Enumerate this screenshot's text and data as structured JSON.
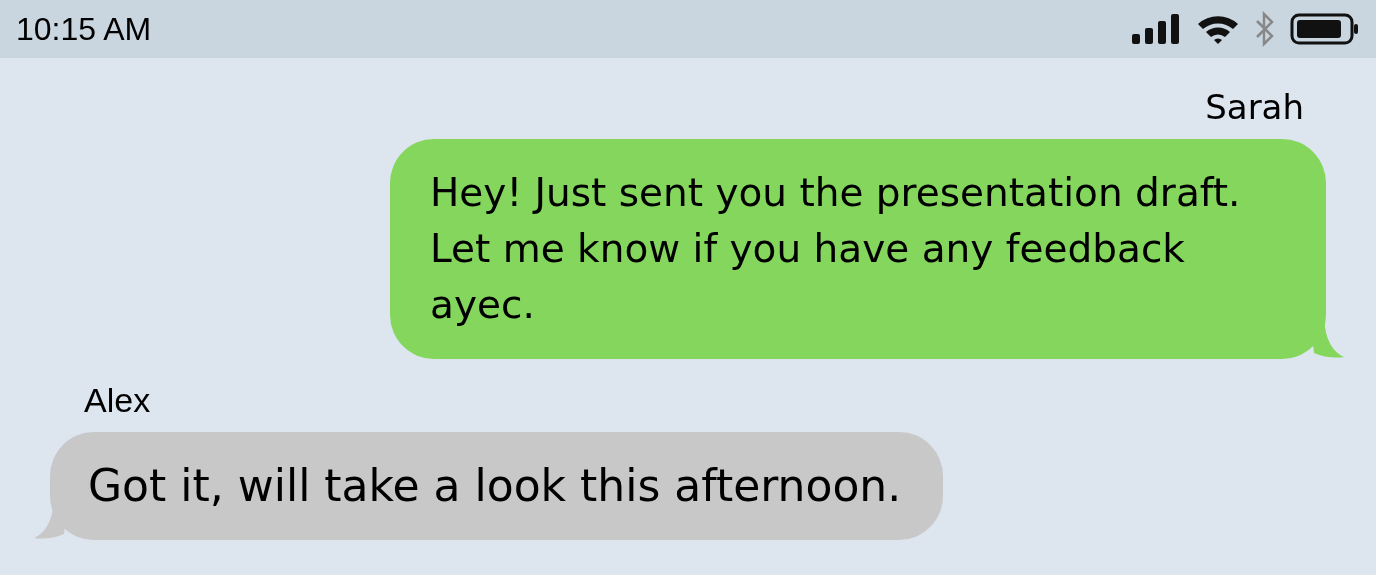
{
  "status_bar": {
    "time": "10:15 AM"
  },
  "messages": [
    {
      "sender": "Sarah",
      "text": "Hey! Just sent you the presentation draft. Let me know if you have any feedback ayec.",
      "kind": "sent"
    },
    {
      "sender": "Alex",
      "text": "Got it, will take a look this afternoon.",
      "kind": "received"
    }
  ]
}
